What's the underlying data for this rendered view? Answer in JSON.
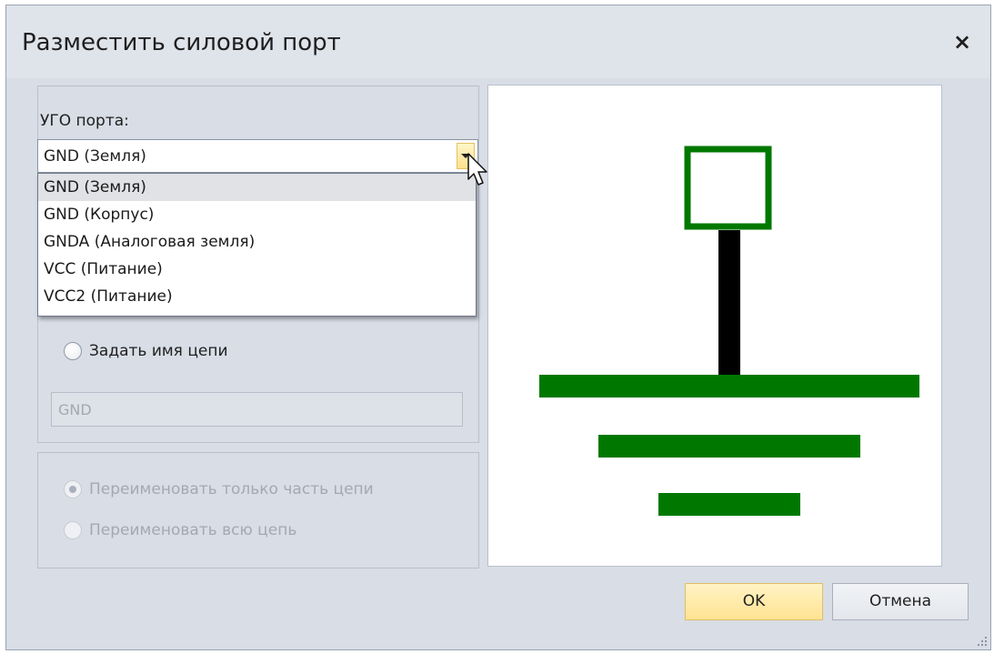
{
  "dialog": {
    "title": "Разместить силовой порт",
    "close_glyph": "×"
  },
  "port_symbol": {
    "label": "УГО порта:",
    "selected": "GND (Земля)",
    "options": [
      "GND (Земля)",
      "GND (Корпус)",
      "GNDA (Аналоговая земля)",
      "VCC (Питание)",
      "VCC2 (Питание)"
    ],
    "highlighted_index": 0
  },
  "net": {
    "set_name_label": "Задать имя цепи",
    "name_value": "GND"
  },
  "rename": {
    "part_label": "Переименовать только часть цепи",
    "part_checked": true,
    "whole_label": "Переименовать всю цепь",
    "whole_checked": false
  },
  "preview": {
    "colors": {
      "symbol": "#007800",
      "stem": "#000000",
      "background": "#ffffff"
    }
  },
  "buttons": {
    "ok": "OK",
    "cancel": "Отмена"
  },
  "icons": {
    "close": "close-icon",
    "dropdown": "chevron-down-icon",
    "cursor": "mouse-pointer-icon",
    "grip": "resize-grip-icon"
  }
}
